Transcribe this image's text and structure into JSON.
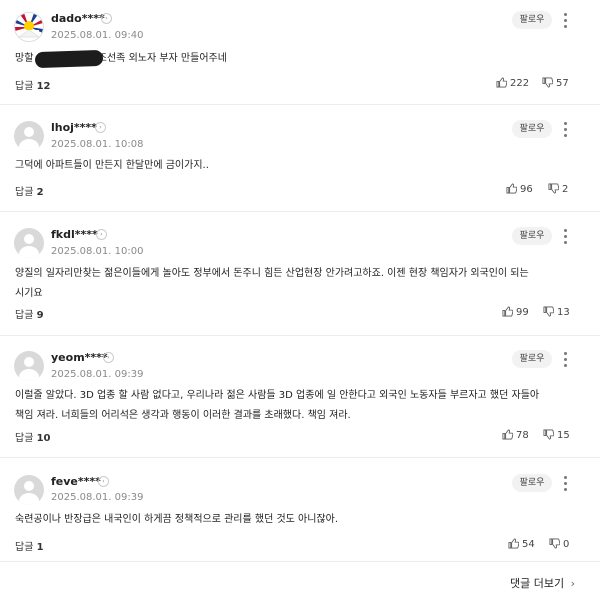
{
  "ui": {
    "follow_label": "팔로우",
    "reply_label": "답글",
    "more_comments_label": "댓글 더보기",
    "chevron": "›"
  },
  "comments": [
    {
      "user": "dado****",
      "date": "2025.08.01. 09:40",
      "text_before_redact": "망할",
      "text": "이 조선족 외노자 부자 만들어주네",
      "replies": "12",
      "likes": "222",
      "dislikes": "57",
      "avatar": "flag-avatar"
    },
    {
      "user": "lhoj****",
      "date": "2025.08.01. 10:08",
      "text": "그덕에 아파트들이 만든지 한달만에 금이가지..",
      "replies": "2",
      "likes": "96",
      "dislikes": "2",
      "avatar": "default-avatar"
    },
    {
      "user": "fkdl****",
      "date": "2025.08.01. 10:00",
      "text": "양질의 일자리만찾는 젊은이들에게 놀아도 정부에서 돈주니 힘든 산업현장 안가려고하죠. 이젠 현장 책임자가 외국인이 되는",
      "text2": "시기요",
      "replies": "9",
      "likes": "99",
      "dislikes": "13",
      "avatar": "default-avatar"
    },
    {
      "user": "yeom****",
      "date": "2025.08.01. 09:39",
      "text": "이럴줄 알았다. 3D 업종 할 사람 없다고, 우리나라 젊은 사람들 3D 업종에 일 안한다고 외국인 노동자들 부르자고 했던 자들아",
      "text2": "책임 져라. 너희들의 어리석은 생각과 행동이 이러한 결과를 초래했다. 책임 져라.",
      "replies": "10",
      "likes": "78",
      "dislikes": "15",
      "avatar": "default-avatar"
    },
    {
      "user": "feve****",
      "date": "2025.08.01. 09:39",
      "text": "숙련공이나 반장급은 내국인이 하게끔 정책적으로 관리를 했던 것도 아니잖아.",
      "replies": "1",
      "likes": "54",
      "dislikes": "0",
      "avatar": "default-avatar"
    }
  ]
}
